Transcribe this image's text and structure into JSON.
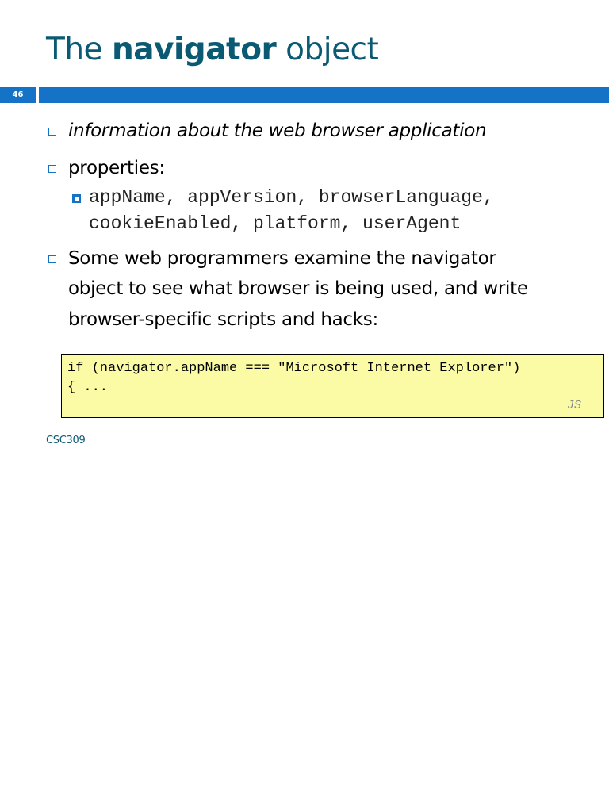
{
  "slide": {
    "title_prefix": "The ",
    "title_bold": "navigator",
    "title_suffix": " object",
    "number": "46",
    "footer": "CSC309"
  },
  "bullets": {
    "b1": "information about the web browser application",
    "b2": "properties:",
    "sub1_line1": "appName, appVersion, browserLanguage,",
    "sub1_line2": "cookieEnabled, platform, userAgent",
    "b3_line1": "Some web programmers examine the navigator",
    "b3_line2": "object to see what browser is being used, and write",
    "b3_line3": "browser-specific scripts and hacks:"
  },
  "code": {
    "line1": "if (navigator.appName === \"Microsoft Internet Explorer\")",
    "line2": "{ ...",
    "lang": "JS"
  },
  "colors": {
    "title": "#0b5a74",
    "accent_bar": "#1473c7",
    "code_background": "#fbfba6"
  }
}
